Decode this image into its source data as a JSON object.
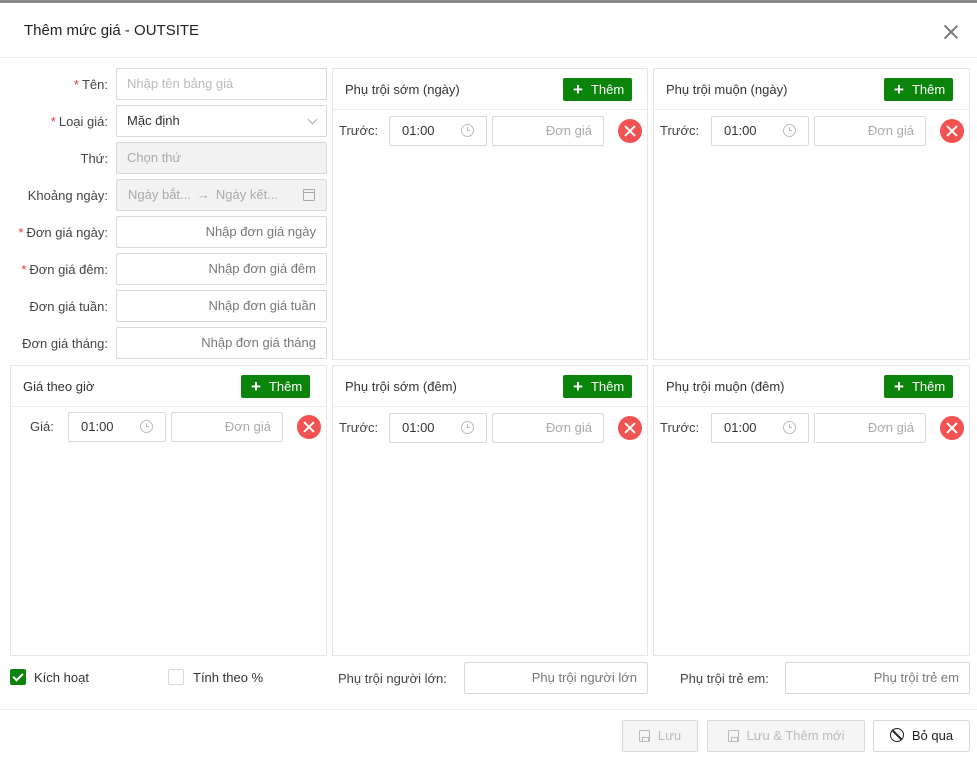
{
  "dialog": {
    "title": "Thêm mức giá - OUTSITE"
  },
  "form": {
    "name": {
      "label": "Tên:",
      "placeholder": "Nhập tên bảng giá"
    },
    "price_type": {
      "label": "Loại giá:",
      "value": "Mặc định"
    },
    "weekday": {
      "label": "Thứ:",
      "placeholder": "Chọn thứ"
    },
    "date_range": {
      "label": "Khoảng ngày:",
      "start_placeholder": "Ngày bắt...",
      "arrow": "→",
      "end_placeholder": "Ngày kết..."
    },
    "day_price": {
      "label": "Đơn giá ngày:",
      "placeholder": "Nhập đơn giá ngày"
    },
    "night_price": {
      "label": "Đơn giá đêm:",
      "placeholder": "Nhập đơn giá đêm"
    },
    "week_price": {
      "label": "Đơn giá tuần:",
      "placeholder": "Nhập đơn giá tuần"
    },
    "month_price": {
      "label": "Đơn giá tháng:",
      "placeholder": "Nhập đơn giá tháng"
    }
  },
  "common": {
    "add_label": "Thêm",
    "before_label": "Trước:",
    "price_label": "Giá:",
    "time_value": "01:00",
    "unit_price_placeholder": "Đơn giá"
  },
  "panels": {
    "early_day": {
      "title": "Phụ trội sớm (ngày)"
    },
    "late_day": {
      "title": "Phụ trội muộn (ngày)"
    },
    "hourly": {
      "title": "Giá theo giờ"
    },
    "early_night": {
      "title": "Phụ trội sớm (đêm)"
    },
    "late_night": {
      "title": "Phụ trội muộn (đêm)"
    }
  },
  "bottom": {
    "active": {
      "label": "Kích hoạt",
      "checked": true
    },
    "percent": {
      "label": "Tính theo %",
      "checked": false
    },
    "adult_surcharge": {
      "label": "Phụ trội người lớn:",
      "placeholder": "Phụ trội người lớn"
    },
    "child_surcharge": {
      "label": "Phụ trội trẻ em:",
      "placeholder": "Phụ trội trẻ em"
    }
  },
  "footer": {
    "save": "Lưu",
    "save_and_new": "Lưu & Thêm mới",
    "skip": "Bỏ qua"
  },
  "colors": {
    "primary_green": "#0b840b",
    "danger_red": "#f25252",
    "required_red": "#e53935"
  }
}
